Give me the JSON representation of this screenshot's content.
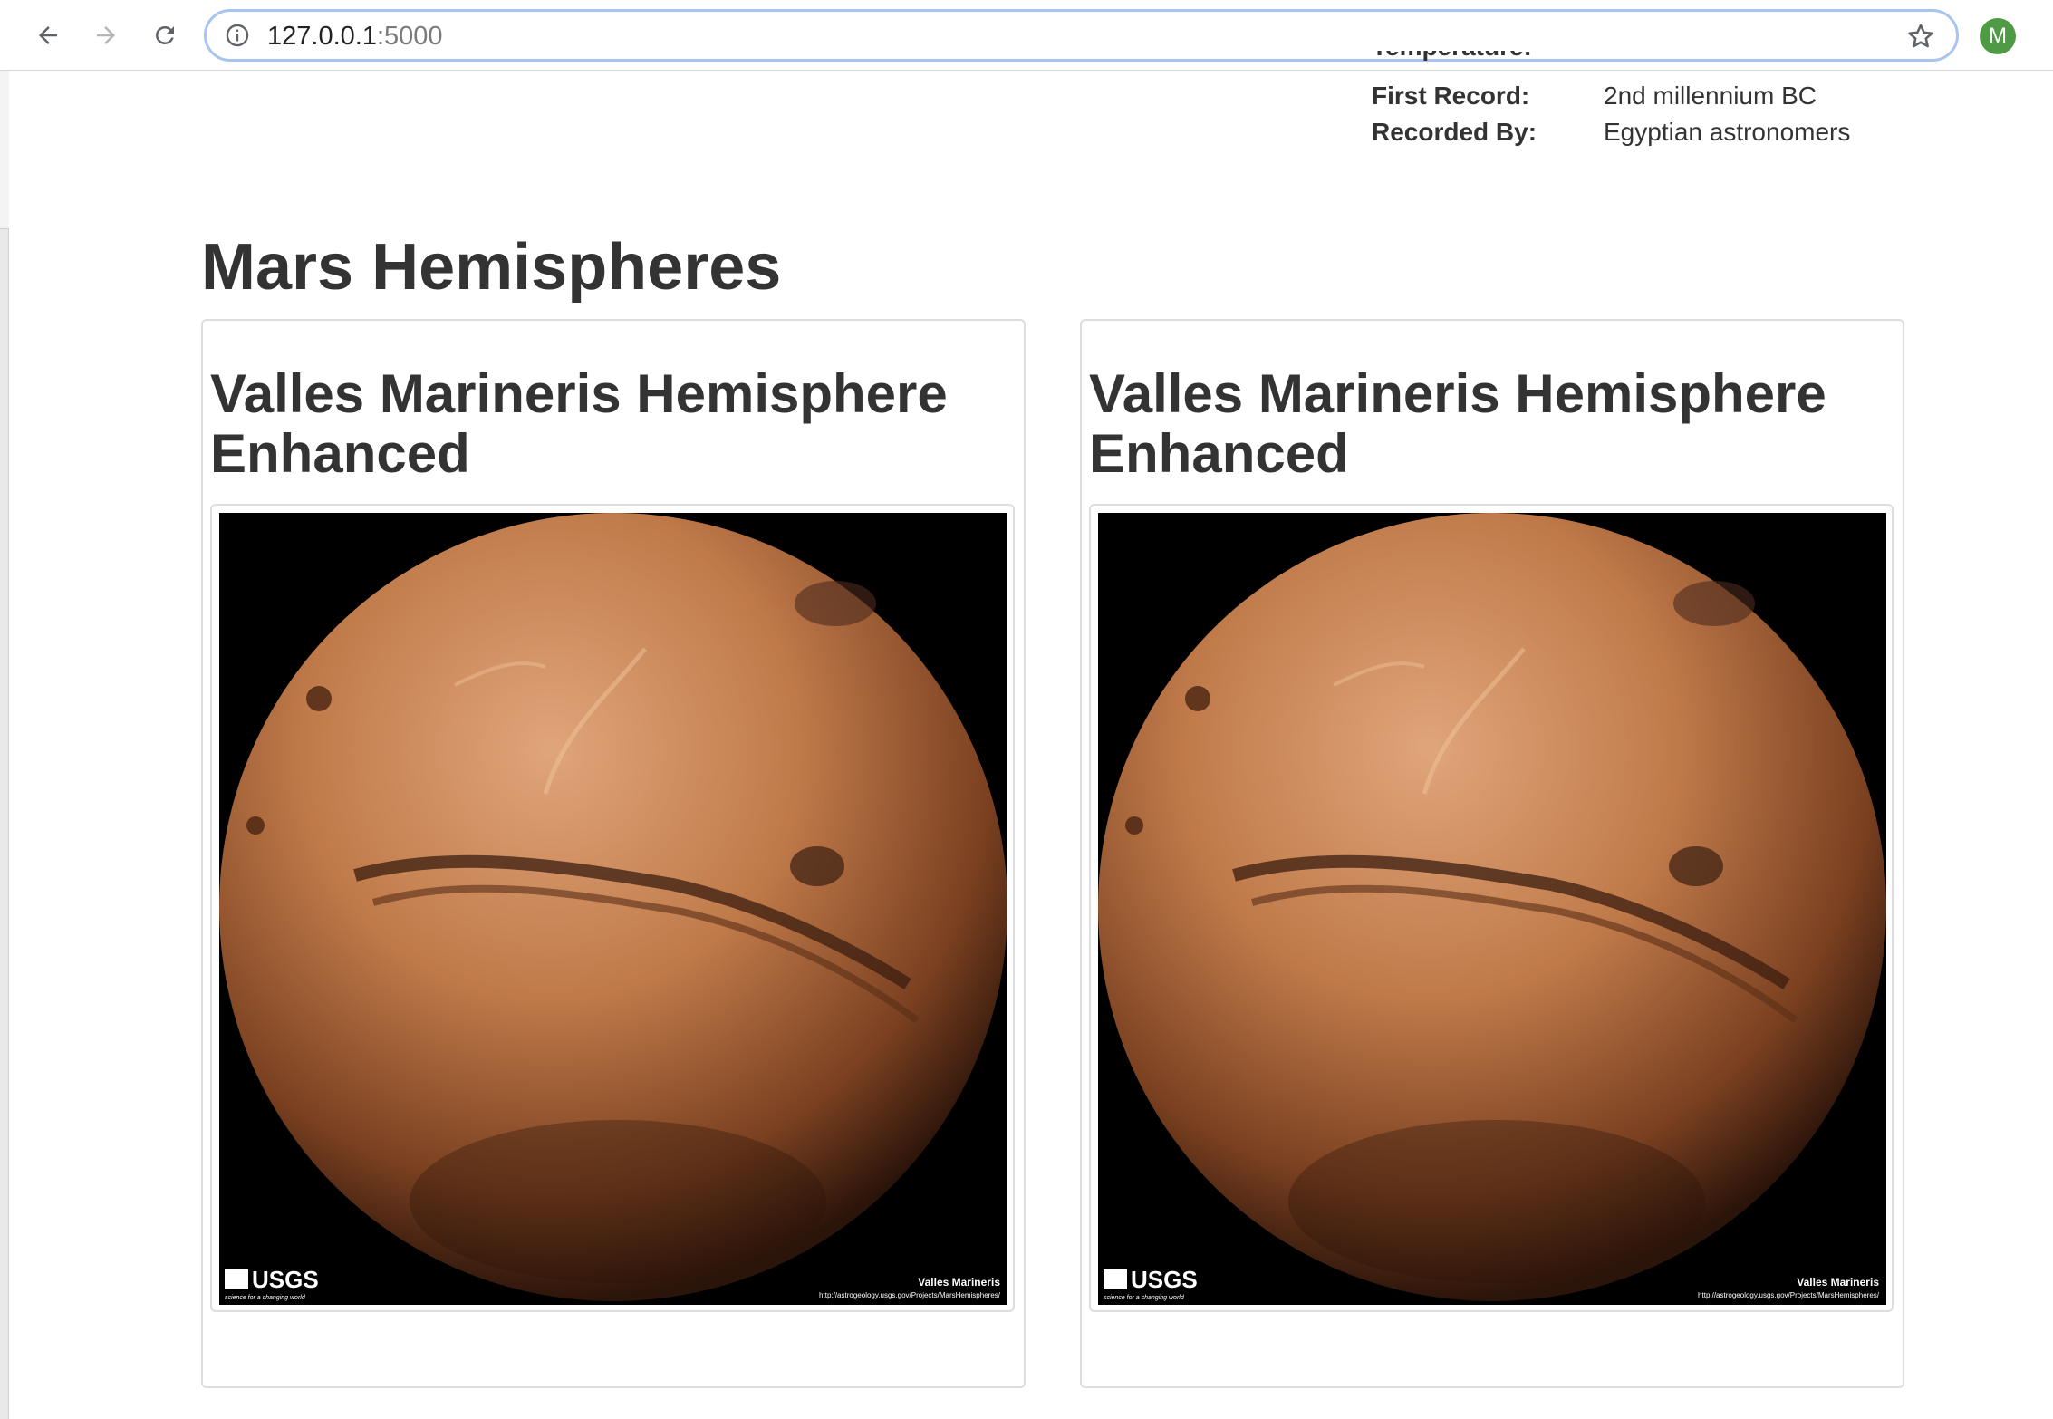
{
  "browser": {
    "url_host": "127.0.0.1",
    "url_port": ":5000",
    "profile_initial": "M"
  },
  "facts": [
    {
      "label": "Temperature:",
      "value": ""
    },
    {
      "label": "First Record:",
      "value": "2nd millennium BC"
    },
    {
      "label": "Recorded By:",
      "value": "Egyptian astronomers"
    }
  ],
  "section_title": "Mars Hemispheres",
  "hemispheres": [
    {
      "title": "Valles Marineris Hemisphere Enhanced",
      "image_caption": "Valles Marineris",
      "image_url_text": "http://astrogeology.usgs.gov/Projects/MarsHemispheres/",
      "logo_text": "USGS",
      "logo_tagline": "science for a changing world"
    },
    {
      "title": "Valles Marineris Hemisphere Enhanced",
      "image_caption": "Valles Marineris",
      "image_url_text": "http://astrogeology.usgs.gov/Projects/MarsHemispheres/",
      "logo_text": "USGS",
      "logo_tagline": "science for a changing world"
    }
  ],
  "colors": {
    "mars_light": "#d99a6c",
    "mars_mid": "#b36b40",
    "mars_dark": "#3b1d10",
    "avatar": "#4e9a45",
    "omnibox_border": "#a9c4ee"
  },
  "icons": {
    "back": "arrow-left-icon",
    "forward": "arrow-right-icon",
    "reload": "reload-icon",
    "info": "info-icon",
    "bookmark": "star-icon"
  }
}
